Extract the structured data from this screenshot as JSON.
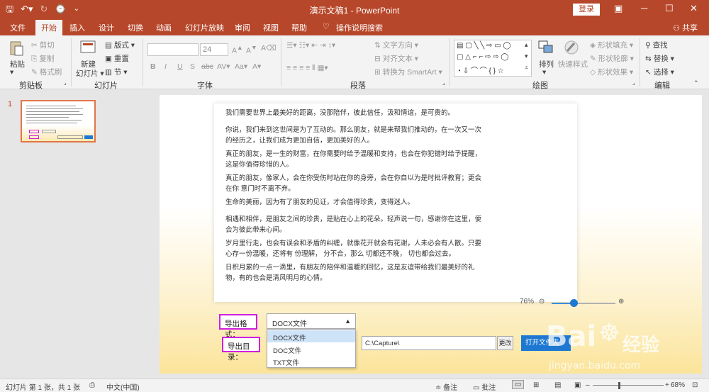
{
  "titlebar": {
    "title": "演示文稿1 - PowerPoint",
    "login_label": "登录"
  },
  "tabs": [
    {
      "label": "文件"
    },
    {
      "label": "开始"
    },
    {
      "label": "插入"
    },
    {
      "label": "设计"
    },
    {
      "label": "切换"
    },
    {
      "label": "动画"
    },
    {
      "label": "幻灯片放映"
    },
    {
      "label": "审阅"
    },
    {
      "label": "视图"
    },
    {
      "label": "帮助"
    },
    {
      "label": "操作说明搜索"
    }
  ],
  "share_label": "共享",
  "ribbon": {
    "clipboard": {
      "paste": "粘贴",
      "cut": "剪切",
      "copy": "复制",
      "format_painter": "格式刷",
      "label": "剪贴板"
    },
    "slides": {
      "new_slide": "新建",
      "new_slide_2": "幻灯片",
      "layout": "版式",
      "reset": "重置",
      "section": "节",
      "label": "幻灯片"
    },
    "font": {
      "size": "24",
      "label": "字体"
    },
    "paragraph": {
      "text_direction": "文字方向",
      "align_text": "对齐文本",
      "smartart": "转换为 SmartArt",
      "label": "段落"
    },
    "drawing": {
      "arrange": "排列",
      "quick_styles": "快速样式",
      "fill": "形状填充",
      "outline": "形状轮廓",
      "effects": "形状效果",
      "label": "绘图"
    },
    "editing": {
      "find": "查找",
      "replace": "替换",
      "select": "选择",
      "label": "编辑"
    }
  },
  "thumbnail": {
    "number": "1"
  },
  "document": {
    "paragraphs": [
      "我们需要世界上最美好的距离，没那陪伴，彼此信任，汲和情谊，是可贵的。",
      "你说，我们来到这世间是为了互动的。那么朋友，就是来帮我们推动的，在一次又一次的经历之，让我们成为更加自信，更加美好的人。",
      "真正的朋友，是一生的财富，在你需要时给予温暖和支持，也会在你犯错时给予提醒，这是你值得珍惜的人。",
      "真正的朋友，像家人，会在你受伤时站在你的身旁，会在你自以为是时批评教育；更会在你  意门时不离不弃。",
      "生命的美丽，因为有了朋友的见证，才会值得珍贵，变得迷人。",
      "相遇和相伴，是朋友之间的珍贵，是贴在心上的花朵。轻声说一句，感谢你在这里，便会为彼此带来心间。",
      "岁月里行走，也会有误会和矛盾的纠缠，就像花开就会有花谢，人未必会有人散。只要心存一份温暖，还将有   份理解，    分不合，那么   切都还不晚，    切也都会过去。",
      "日积月累的一点一滴里，有朋友的陪伴和温暖的回忆，这是友谊带给我们最美好的礼物，有的也会是清风明月的心情。"
    ],
    "zoom": "76%"
  },
  "export": {
    "format_label": "导出格式：",
    "format_value": "DOCX文件",
    "options": [
      "DOCX文件",
      "DOC文件",
      "TXT文件"
    ],
    "dir_label": "导出目录：",
    "dir_value": "C:\\Capture\\",
    "change_label": "更改",
    "open_label": "打开文件夹"
  },
  "statusbar": {
    "slide_info": "幻灯片 第 1 张，共 1 张",
    "language": "中文(中国)",
    "notes": "备注",
    "comments": "批注",
    "zoom": "68%"
  },
  "watermark": {
    "brand": "Bai",
    "brand2": "du",
    "word": "经验",
    "url": "jingyan.baidu.com"
  },
  "colors": {
    "accent": "#b7472a",
    "highlight_border": "#d21ee0",
    "primary_blue": "#1e78d2"
  }
}
